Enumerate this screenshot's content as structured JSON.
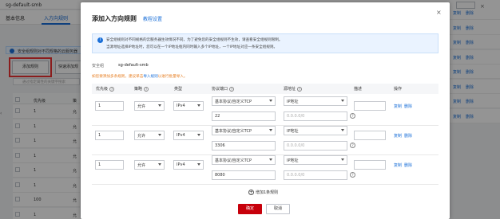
{
  "background": {
    "title": "sg-default-smb",
    "tabs": [
      "基本信息",
      "入方向规则"
    ],
    "info_text": "安全组规则对不同规格的云服务器",
    "add_rule_label": "添加规则",
    "quick_add_label": "快速添加规",
    "search_placeholder": "通过指定属性的关键字搜索",
    "table_headers": [
      "优先级",
      "策"
    ],
    "rows": [
      {
        "priority": "1",
        "policy": "允"
      },
      {
        "priority": "1",
        "policy": "允"
      },
      {
        "priority": "1",
        "policy": "允"
      },
      {
        "priority": "1",
        "policy": "允"
      },
      {
        "priority": "1",
        "policy": "允"
      },
      {
        "priority": "1",
        "policy": "允"
      },
      {
        "priority": "100",
        "policy": "允"
      },
      {
        "priority": "1",
        "policy": "允"
      }
    ],
    "right_links": {
      "copy": "复制",
      "delete": "删除"
    }
  },
  "modal": {
    "title": "添加入方向规则",
    "tutorial_link": "教程设置",
    "close": "×",
    "notice_line1": "安全组规则对不同规格的云服务器生效情况不同，为了避免您的安全组规则不生效，请查看安全组规则限制。",
    "notice_line2": "当源地址选择IP地址时，您可以在一个IP地址框内同时输入多个IP地址，一个IP地址对应一条安全组规则。",
    "sg_label": "安全组",
    "sg_value": "sg-default-smb",
    "hint_prefix": "如您要添加多条规则，建议单击",
    "hint_link": "导入规则",
    "hint_suffix": "以进行批量导入。",
    "headers": {
      "priority": "优先级",
      "policy": "策略",
      "type": "类型",
      "protocol_port": "协议端口",
      "source": "源地址",
      "description": "描述",
      "operation": "操作"
    },
    "rules": [
      {
        "priority": "1",
        "policy": "允许",
        "type": "IPv4",
        "protocol": "基本协议/自定义TCP",
        "port": "22",
        "source_type": "IP地址",
        "source_ip": "0.0.0.0/0",
        "description": ""
      },
      {
        "priority": "1",
        "policy": "允许",
        "type": "IPv4",
        "protocol": "基本协议/自定义TCP",
        "port": "3306",
        "source_type": "IP地址",
        "source_ip": "0.0.0.0/0",
        "description": ""
      },
      {
        "priority": "1",
        "policy": "允许",
        "type": "IPv4",
        "protocol": "基本协议/自定义TCP",
        "port": "8080",
        "source_type": "IP地址",
        "source_ip": "0.0.0.0/0",
        "description": ""
      }
    ],
    "row_actions": {
      "copy": "复制",
      "delete": "删除"
    },
    "add_more": "增加1条规则",
    "ok": "确定",
    "cancel": "取消"
  },
  "colors": {
    "accent": "#1a6fd8",
    "primary_button": "#c7000b",
    "highlight": "#ee3333"
  }
}
